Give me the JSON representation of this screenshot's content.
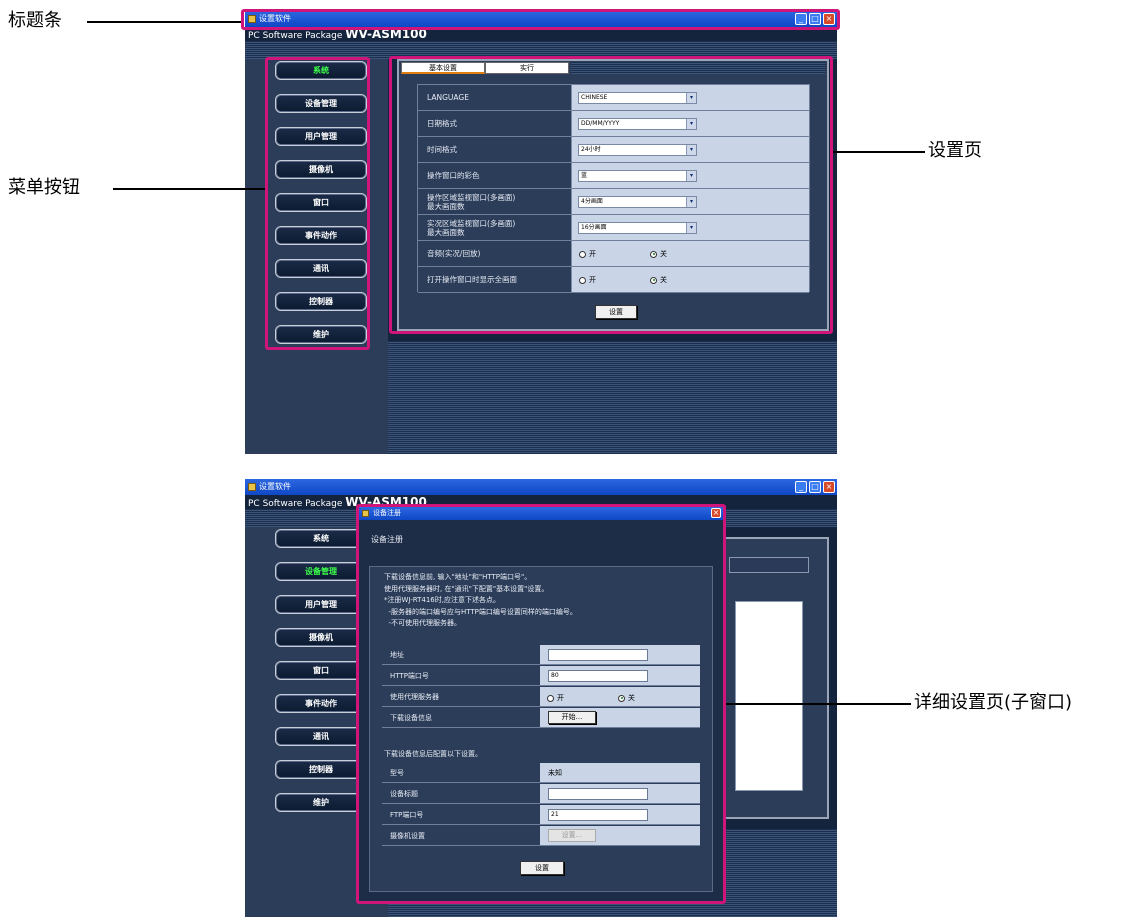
{
  "annotations": {
    "titlebar": "标题条",
    "menu_buttons": "菜单按钮",
    "settings_page": "设置页",
    "detail_page": "详细设置页(子窗口)"
  },
  "window1": {
    "title": "设置软件",
    "brand_prefix": "PC Software Package",
    "brand_model": "WV-ASM100",
    "menu": [
      "系统",
      "设备管理",
      "用户管理",
      "摄像机",
      "窗口",
      "事件动作",
      "通讯",
      "控制器",
      "维护"
    ],
    "active_menu": "系统",
    "tabs": [
      "基本设置",
      "实行"
    ],
    "rows": [
      {
        "label": "LANGUAGE",
        "value": "CHINESE",
        "type": "select"
      },
      {
        "label": "日期格式",
        "value": "DD/MM/YYYY",
        "type": "select"
      },
      {
        "label": "时间格式",
        "value": "24小时",
        "type": "select"
      },
      {
        "label": "操作窗口的彩色",
        "value": "蓝",
        "type": "select"
      },
      {
        "label": "操作区域监视窗口(多画面)\n最大画面数",
        "value": "4分画面",
        "type": "select"
      },
      {
        "label": "实况区域监视窗口(多画面)\n最大画面数",
        "value": "16分画面",
        "type": "select"
      },
      {
        "label": "音频(实况/回放)",
        "on": "开",
        "off": "关",
        "selected": "关",
        "type": "radio"
      },
      {
        "label": "打开操作窗口时显示全画面",
        "on": "开",
        "off": "关",
        "selected": "关",
        "type": "radio"
      }
    ],
    "set_button": "设置"
  },
  "window2": {
    "title": "设置软件",
    "brand_prefix": "PC Software Package",
    "brand_model": "WV-ASM100",
    "menu": [
      "系统",
      "设备管理",
      "用户管理",
      "摄像机",
      "窗口",
      "事件动作",
      "通讯",
      "控制器",
      "维护"
    ],
    "active_menu": "设备管理",
    "child": {
      "title": "设备注册",
      "heading": "设备注册",
      "info": [
        "下载设备信息前, 输入\"地址\"和\"HTTP端口号\"。",
        "使用代理服务器时, 在\"通讯\"下配置\"基本设置\"设置。",
        "*注册WJ-RT416时,应注意下述各点。",
        "  -服务器的端口编号应与HTTP端口编号设置同样的端口编号。",
        "  -不可使用代理服务器。"
      ],
      "rows1": [
        {
          "label": "地址",
          "type": "input",
          "value": ""
        },
        {
          "label": "HTTP端口号",
          "type": "input",
          "value": "80"
        },
        {
          "label": "使用代理服务器",
          "type": "radio",
          "on": "开",
          "off": "关",
          "selected": "关"
        },
        {
          "label": "下载设备信息",
          "type": "button",
          "value": "开始..."
        }
      ],
      "note2": "下载设备信息后配置以下设置。",
      "rows2": [
        {
          "label": "型号",
          "type": "text",
          "value": "未知"
        },
        {
          "label": "设备标题",
          "type": "input",
          "value": ""
        },
        {
          "label": "FTP端口号",
          "type": "input",
          "value": "21"
        },
        {
          "label": "摄像机设置",
          "type": "button",
          "value": "设置..."
        }
      ],
      "set_button": "设置"
    }
  }
}
